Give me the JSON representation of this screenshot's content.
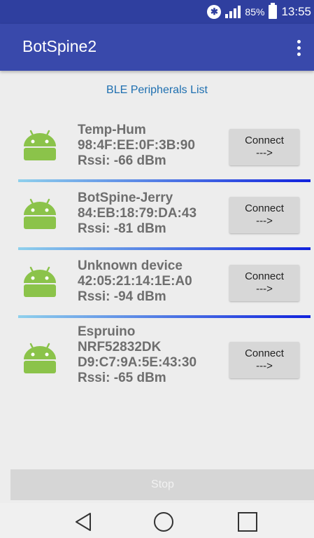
{
  "status_bar": {
    "battery_percent": "85%",
    "time": "13:55",
    "icons": [
      "bluetooth-icon",
      "signal-icon",
      "battery-icon"
    ]
  },
  "app_bar": {
    "title": "BotSpine2",
    "menu_icon": "overflow-menu-icon"
  },
  "list_header": "BLE Peripherals List",
  "devices": [
    {
      "lines": [
        "Temp-Hum",
        "98:4F:EE:0F:3B:90",
        "Rssi: -66 dBm"
      ],
      "button_line1": "Connect",
      "button_line2": "--->"
    },
    {
      "lines": [
        "BotSpine-Jerry",
        "84:EB:18:79:DA:43",
        "Rssi: -81 dBm"
      ],
      "button_line1": "Connect",
      "button_line2": "--->"
    },
    {
      "lines": [
        "Unknown device",
        "42:05:21:14:1E:A0",
        "Rssi: -94 dBm"
      ],
      "button_line1": "Connect",
      "button_line2": "--->"
    },
    {
      "lines": [
        "Espruino",
        "NRF52832DK",
        "D9:C7:9A:5E:43:30",
        "Rssi: -65 dBm"
      ],
      "button_line1": "Connect",
      "button_line2": "--->"
    }
  ],
  "stop_button": "Stop",
  "nav_bar": {
    "icons": [
      "back-icon",
      "home-icon",
      "recents-icon"
    ]
  },
  "colors": {
    "status_bar": "#2f3f9f",
    "app_bar": "#3949ab",
    "header_text": "#1e6fb0",
    "android_green": "#8bc34a"
  }
}
